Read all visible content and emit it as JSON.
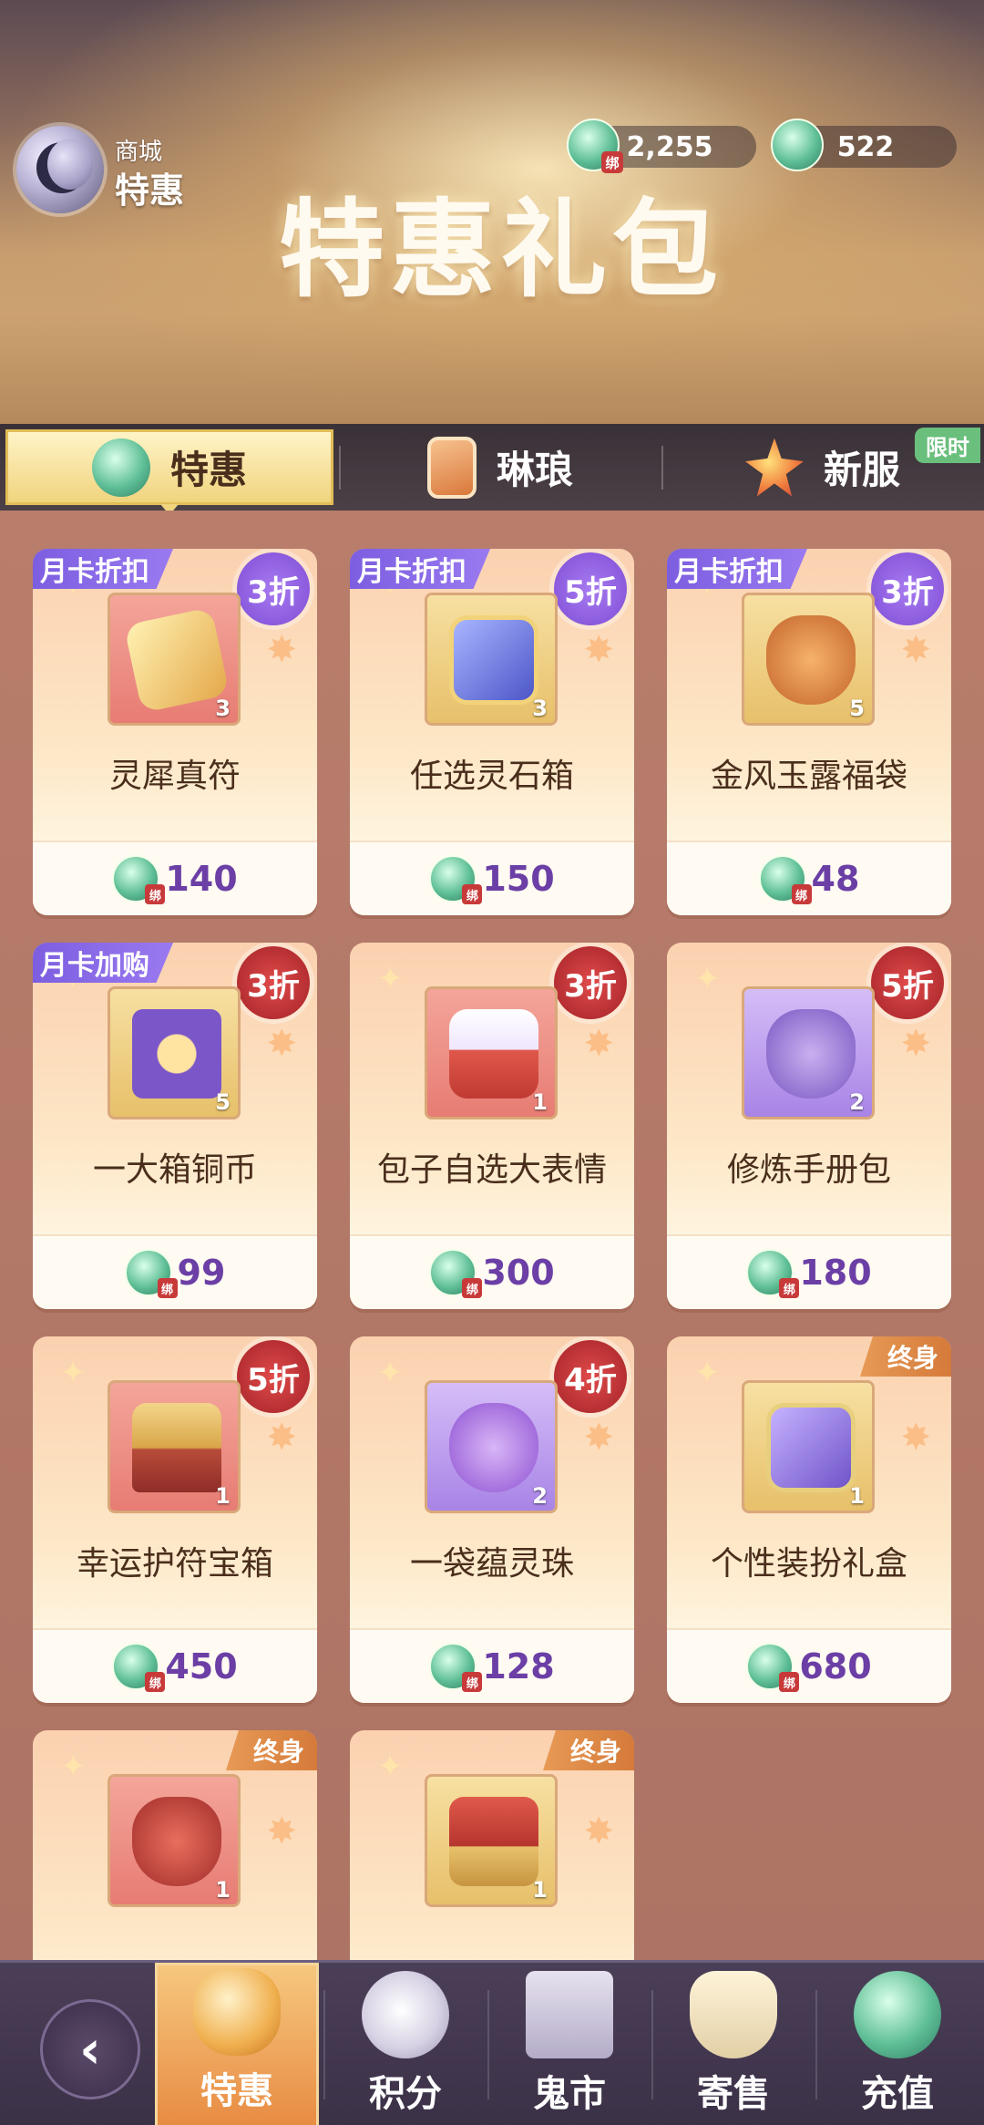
{
  "header": {
    "shop_subtitle": "商城",
    "shop_name": "特惠",
    "title": "特惠礼包",
    "currencies": [
      {
        "name": "bound-jade",
        "value": "2,255"
      },
      {
        "name": "jade",
        "value": "522"
      }
    ]
  },
  "tabs": [
    {
      "label": "特惠",
      "icon": "jade-icon"
    },
    {
      "label": "琳琅",
      "icon": "card-icon"
    },
    {
      "label": "新服",
      "icon": "star-flower-icon",
      "badge": "限时"
    }
  ],
  "items": [
    {
      "name": "灵犀真符",
      "qty": "3",
      "price": "140",
      "tag": "月卡折扣",
      "discount": "3折"
    },
    {
      "name": "任选灵石箱",
      "qty": "3",
      "price": "150",
      "tag": "月卡折扣",
      "discount": "5折"
    },
    {
      "name": "金风玉露福袋",
      "qty": "5",
      "price": "48",
      "tag": "月卡折扣",
      "discount": "3折"
    },
    {
      "name": "一大箱铜币",
      "qty": "5",
      "price": "99",
      "tag": "月卡加购",
      "discount": "3折"
    },
    {
      "name": "包子自选大表情",
      "qty": "1",
      "price": "300",
      "discount": "3折"
    },
    {
      "name": "修炼手册包",
      "qty": "2",
      "price": "180",
      "discount": "5折"
    },
    {
      "name": "幸运护符宝箱",
      "qty": "1",
      "price": "450",
      "discount": "5折"
    },
    {
      "name": "一袋蕴灵珠",
      "qty": "2",
      "price": "128",
      "discount": "4折"
    },
    {
      "name": "个性装扮礼盒",
      "qty": "1",
      "price": "680",
      "lifetime": "终身"
    },
    {
      "qty": "1",
      "lifetime": "终身"
    },
    {
      "qty": "1",
      "lifetime": "终身"
    }
  ],
  "bottom_nav": [
    {
      "label": "特惠"
    },
    {
      "label": "积分"
    },
    {
      "label": "鬼市"
    },
    {
      "label": "寄售"
    },
    {
      "label": "充值"
    }
  ]
}
